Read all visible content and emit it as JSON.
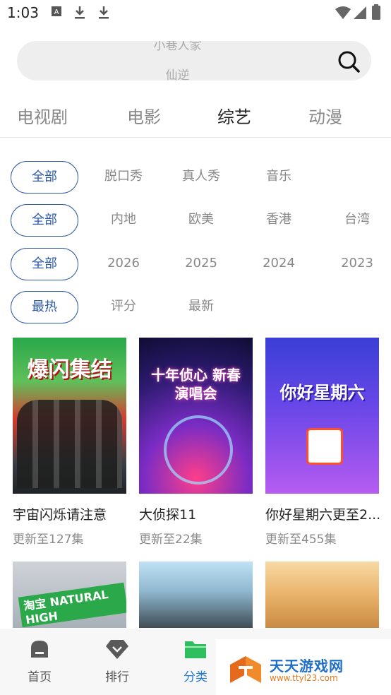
{
  "status": {
    "time": "1:03"
  },
  "search": {
    "hint_prev": "小巷人家",
    "hint_current": "仙逆"
  },
  "category_tabs": [
    {
      "label": "电视剧"
    },
    {
      "label": "电影"
    },
    {
      "label": "综艺"
    },
    {
      "label": "动漫"
    }
  ],
  "active_tab": "综艺",
  "filters": {
    "type": [
      "全部",
      "脱口秀",
      "真人秀",
      "音乐"
    ],
    "region": [
      "全部",
      "内地",
      "欧美",
      "香港",
      "台湾"
    ],
    "year": [
      "全部",
      "2026",
      "2025",
      "2024",
      "2023"
    ],
    "sort": [
      "最热",
      "评分",
      "最新"
    ]
  },
  "shows": [
    {
      "title": "宇宙闪烁请注意",
      "subtitle": "更新至127集",
      "poster_text": "爆闪集结"
    },
    {
      "title": "大侦探11",
      "subtitle": "更新至22集",
      "poster_text": "十年侦心 新春演唱会"
    },
    {
      "title": "你好星期六更至2...",
      "subtitle": "更新至455集",
      "poster_text": "你好星期六"
    }
  ],
  "row2_posters": [
    {
      "poster_text": "淘宝 NATURAL HIGH"
    },
    {
      "poster_text": ""
    },
    {
      "poster_text": ""
    }
  ],
  "bottom_nav": [
    {
      "label": "首页",
      "icon": "home-icon"
    },
    {
      "label": "排行",
      "icon": "rank-icon"
    },
    {
      "label": "分类",
      "icon": "folder-icon"
    }
  ],
  "active_nav": "分类",
  "watermark": {
    "name": "天天游戏网",
    "url": "www.ttyl23.com"
  },
  "colors": {
    "accent": "#2d5aa8",
    "nav_active": "#1f7bd8",
    "nav_active_icon": "#2fbf5e"
  }
}
